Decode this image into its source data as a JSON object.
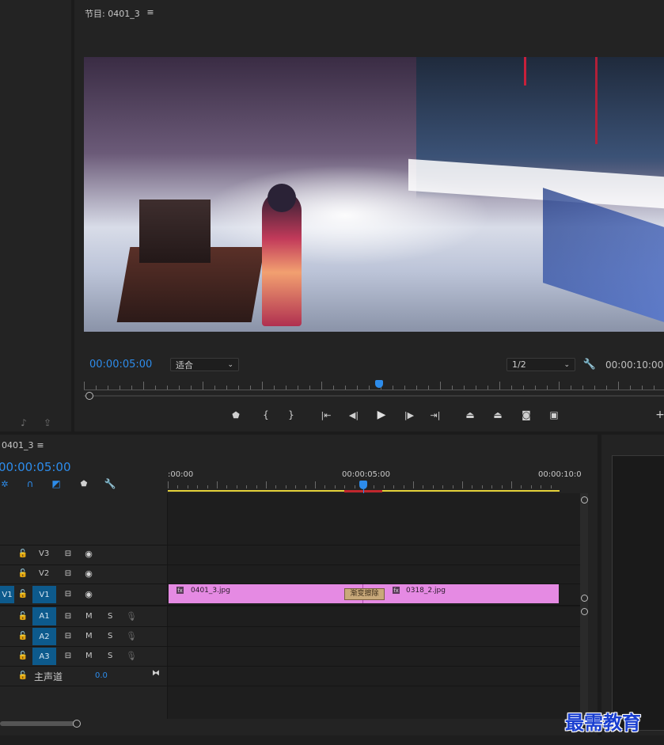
{
  "program_monitor": {
    "title": "节目: 0401_3",
    "menu_icon": "hamburger-menu-icon",
    "current_time": "00:00:05:00",
    "fit_select": "适合",
    "resolution_select": "1/2",
    "duration": "00:00:10:00",
    "transport_icons": [
      "marker-icon",
      "mark-in-icon",
      "mark-out-icon",
      "go-to-in-icon",
      "step-back-icon",
      "play-icon",
      "step-forward-icon",
      "go-to-out-icon",
      "lift-icon",
      "extract-icon",
      "export-frame-icon",
      "compare-view-icon"
    ]
  },
  "left_panel": {
    "icons": [
      "audio-output-icon",
      "share-icon"
    ]
  },
  "timeline": {
    "title": "0401_3",
    "current_time": "00:00:05:00",
    "ruler_labels": [
      ":00:00",
      "00:00:05:00",
      "00:00:10:0"
    ],
    "tools": [
      "snap-icon",
      "linked-selection-icon",
      "insert-icon",
      "add-marker-icon",
      "settings-wrench-icon"
    ],
    "tracks": [
      {
        "id": "V3",
        "type": "video"
      },
      {
        "id": "V2",
        "type": "video"
      },
      {
        "id": "V1",
        "type": "video",
        "source": "V1"
      },
      {
        "id": "A1",
        "type": "audio",
        "mute": "M",
        "solo": "S"
      },
      {
        "id": "A2",
        "type": "audio",
        "mute": "M",
        "solo": "S"
      },
      {
        "id": "A3",
        "type": "audio",
        "mute": "M",
        "solo": "S"
      }
    ],
    "master": {
      "label": "主声道",
      "value": "0.0"
    },
    "clips": [
      {
        "name": "0401_3.jpg",
        "color": "#e58ae3"
      },
      {
        "name": "0318_2.jpg",
        "color": "#e58ae3"
      }
    ],
    "transition": "渐变擦除"
  },
  "watermark": "最需教育",
  "colors": {
    "accent": "#2d8ceb",
    "clip": "#e58ae3",
    "work_area": "#e5d23a",
    "render_bar": "#c0272d"
  }
}
